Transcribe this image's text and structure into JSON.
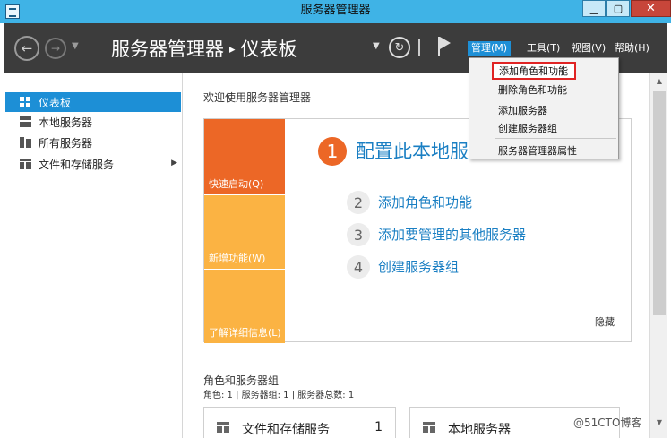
{
  "window": {
    "title": "服务器管理器",
    "min_label": "▁",
    "max_label": "▢",
    "close_label": "✕"
  },
  "header": {
    "breadcrumb_root": "服务器管理器",
    "breadcrumb_sep": "▸",
    "breadcrumb_current": "仪表板",
    "menus": {
      "manage": "管理(M)",
      "tools": "工具(T)",
      "view": "视图(V)",
      "help": "帮助(H)"
    },
    "icons": {
      "back": "back-arrow-icon",
      "forward": "forward-arrow-icon",
      "refresh": "refresh-icon",
      "notifications": "flag-icon"
    }
  },
  "manage_menu": {
    "items": [
      "添加角色和功能",
      "删除角色和功能",
      "添加服务器",
      "创建服务器组",
      "服务器管理器属性"
    ]
  },
  "sidebar": {
    "items": [
      {
        "label": "仪表板",
        "icon": "dashboard-icon",
        "active": true
      },
      {
        "label": "本地服务器",
        "icon": "server-icon"
      },
      {
        "label": "所有服务器",
        "icon": "servers-icon"
      },
      {
        "label": "文件和存储服务",
        "icon": "storage-icon",
        "expandable": true
      }
    ]
  },
  "main": {
    "welcome": "欢迎使用服务器管理器",
    "tiles": {
      "quick_start": "快速启动(Q)",
      "whats_new": "新增功能(W)",
      "learn_more": "了解详细信息(L)"
    },
    "steps": [
      {
        "num": "1",
        "label": "配置此本地服务器"
      },
      {
        "num": "2",
        "label": "添加角色和功能"
      },
      {
        "num": "3",
        "label": "添加要管理的其他服务器"
      },
      {
        "num": "4",
        "label": "创建服务器组"
      }
    ],
    "hide": "隐藏",
    "roles_title": "角色和服务器组",
    "roles_summary": "角色: 1 | 服务器组: 1 | 服务器总数: 1",
    "cards": [
      {
        "title": "文件和存储服务",
        "count": "1"
      },
      {
        "title": "本地服务器",
        "count": ""
      }
    ]
  },
  "watermark": "@51CTO博客",
  "colors": {
    "titlebar": "#3fb3e6",
    "header": "#3c3c3c",
    "accent": "#1d8fd6",
    "quick_start": "#ec6726",
    "tiles": "#fbb343",
    "link": "#1a7fc3",
    "highlight_box": "#e02424"
  }
}
